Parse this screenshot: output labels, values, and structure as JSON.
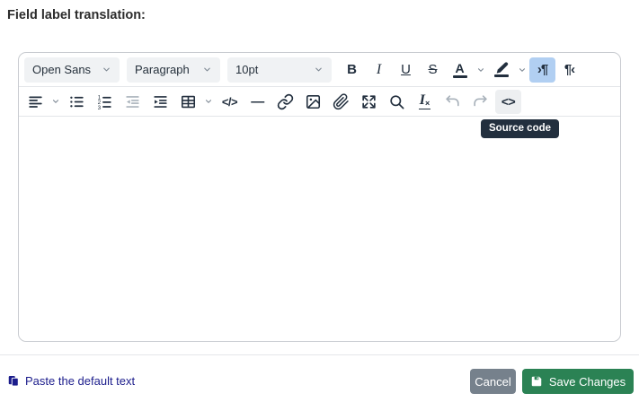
{
  "page": {
    "title": "Field label translation:"
  },
  "colors": {
    "active_direction_bg": "#b1cff2",
    "tooltip_bg": "#222f3e",
    "icon": "#222f3e",
    "icon_disabled": "#a9b2bb",
    "save_green": "#2b8254",
    "cancel_gray": "#76818c",
    "link_navy": "#1c1d8c"
  },
  "editor": {
    "toolbar": {
      "font_family": {
        "value": "Open Sans"
      },
      "block_format": {
        "value": "Paragraph"
      },
      "font_size": {
        "value": "10pt"
      },
      "bold": "B",
      "italic": "I",
      "underline": "U",
      "strikethrough": "S",
      "text_color": "A",
      "ltr": "›¶",
      "rtl": "¶‹",
      "code_sample": "</>",
      "horizontal_rule": "—",
      "source_code": "<>",
      "clear_format_i": "I",
      "clear_format_x": "×"
    },
    "tooltip": "Source code",
    "content": ""
  },
  "footer": {
    "paste_default": "Paste the default text",
    "cancel_label": "Cancel",
    "save_label": "Save Changes"
  },
  "icons": {
    "chevron-down-icon": "∨",
    "align-left-icon": "left-aligned-lines",
    "unordered-list-icon": "bullet-list",
    "ordered-list-icon": "numbered-list",
    "outdent-icon": "lines-with-left-arrow",
    "indent-icon": "lines-with-right-arrow",
    "table-icon": "grid",
    "link-icon": "chain",
    "image-icon": "picture-frame",
    "paperclip-icon": "attachment-clip",
    "fullscreen-icon": "expand-corner-arrows",
    "search-icon": "magnifier",
    "clear-formatting-icon": "italic-I-with-x",
    "undo-icon": "curved-arrow-left",
    "redo-icon": "curved-arrow-right",
    "text-color-icon": "A-over-color-bar",
    "highlight-pen-icon": "marker-pen-over-color-bar",
    "ltr-icon": "pilcrow-arrow-right",
    "rtl-icon": "pilcrow-arrow-left",
    "paste-icon": "two-pages",
    "save-icon": "floppy-disk"
  }
}
